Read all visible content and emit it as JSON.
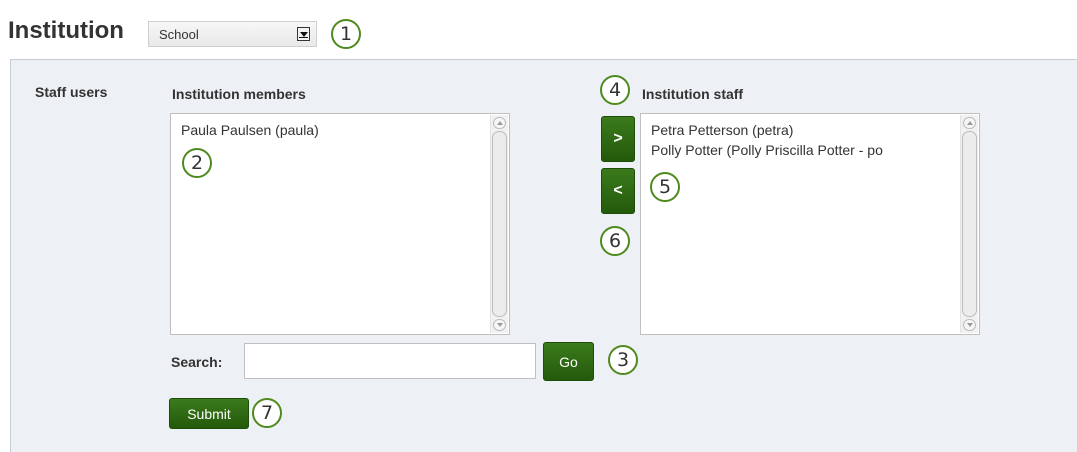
{
  "header": {
    "title": "Institution",
    "institution_select": {
      "value": "School"
    }
  },
  "form": {
    "row_label": "Staff users",
    "members": {
      "label": "Institution members",
      "items": [
        "Paula Paulsen (paula)"
      ]
    },
    "staff": {
      "label": "Institution staff",
      "items": [
        "Petra Petterson (petra)",
        "Polly Potter (Polly Priscilla Potter - po"
      ]
    },
    "move_right_label": ">",
    "move_left_label": "<",
    "search": {
      "label": "Search:",
      "value": "",
      "go_label": "Go"
    },
    "submit_label": "Submit"
  },
  "callouts": [
    "1",
    "2",
    "3",
    "4",
    "5",
    "6",
    "7"
  ],
  "colors": {
    "button_green": "#2f6b14",
    "callout_border": "#4f8a1f",
    "panel_bg": "#edf0f4"
  }
}
